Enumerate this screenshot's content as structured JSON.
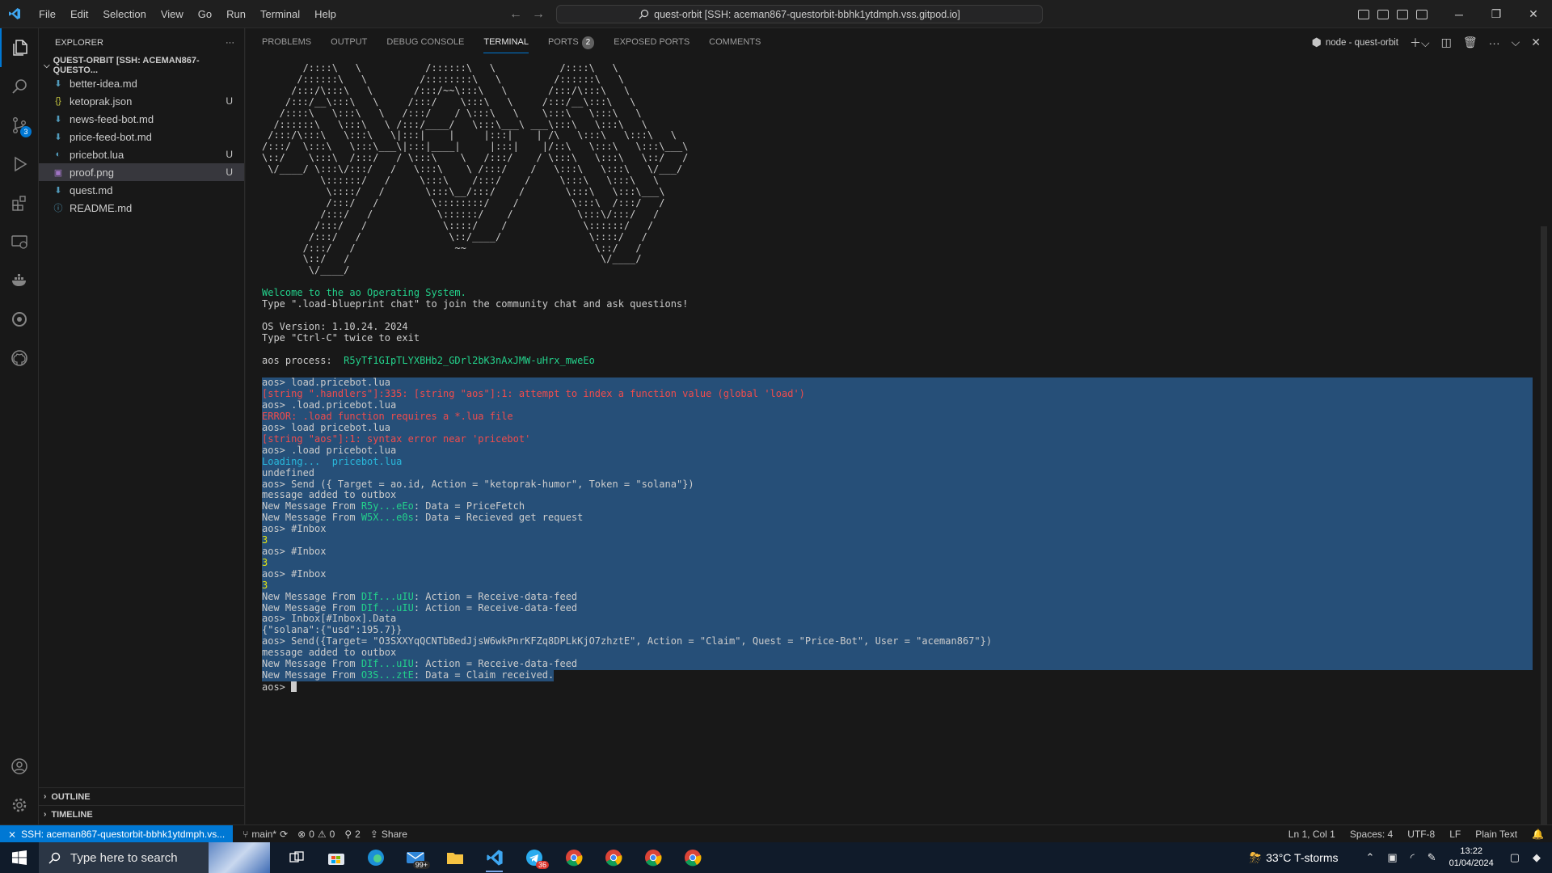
{
  "titlebar": {
    "menu": [
      "File",
      "Edit",
      "Selection",
      "View",
      "Go",
      "Run",
      "Terminal",
      "Help"
    ],
    "command_center": "quest-orbit [SSH: aceman867-questorbit-bbhk1ytdmph.vss.gitpod.io]"
  },
  "activitybar": {
    "scm_badge": "3"
  },
  "sidebar": {
    "title": "EXPLORER",
    "more": "···",
    "folder": "QUEST-ORBIT [SSH: ACEMAN867-QUESTO...",
    "files": [
      {
        "name": "better-idea.md",
        "icon": "markdown-icon",
        "status": ""
      },
      {
        "name": "ketoprak.json",
        "icon": "json-icon",
        "status": "U"
      },
      {
        "name": "news-feed-bot.md",
        "icon": "markdown-icon",
        "status": ""
      },
      {
        "name": "price-feed-bot.md",
        "icon": "markdown-icon",
        "status": ""
      },
      {
        "name": "pricebot.lua",
        "icon": "lua-icon",
        "status": "U"
      },
      {
        "name": "proof.png",
        "icon": "image-icon",
        "status": "U"
      },
      {
        "name": "quest.md",
        "icon": "markdown-icon",
        "status": ""
      },
      {
        "name": "README.md",
        "icon": "info-icon",
        "status": ""
      }
    ],
    "outline": "OUTLINE",
    "timeline": "TIMELINE"
  },
  "panel": {
    "tabs": [
      "PROBLEMS",
      "OUTPUT",
      "DEBUG CONSOLE",
      "TERMINAL",
      "PORTS",
      "EXPOSED PORTS",
      "COMMENTS"
    ],
    "ports_count": "2",
    "terminal_name": "node - quest-orbit"
  },
  "terminal": {
    "ascii_art": "       /::::\\   \\           /::::::\\   \\           /::::\\   \\\n      /::::::\\   \\         /::::::::\\   \\         /::::::\\   \\\n     /:::/\\:::\\   \\       /:::/~~\\:::\\   \\       /:::/\\:::\\   \\\n    /:::/__\\:::\\   \\     /:::/    \\:::\\   \\     /:::/__\\:::\\   \\\n   /::::\\   \\:::\\   \\   /:::/    / \\:::\\   \\    \\:::\\   \\:::\\   \\\n  /::::::\\   \\:::\\   \\ /:::/____/   \\:::\\___\\ ___\\:::\\   \\:::\\   \\\n /:::/\\:::\\   \\:::\\   \\|:::|    |     |:::|    | /\\   \\:::\\   \\:::\\   \\\n/:::/  \\:::\\   \\:::\\___\\|:::|____|     |:::|    |/::\\   \\:::\\   \\:::\\___\\\n\\::/    \\:::\\  /:::/   / \\:::\\    \\   /:::/    / \\:::\\   \\:::\\   \\::/   /\n \\/____/ \\:::\\/:::/   /   \\:::\\    \\ /:::/    /   \\:::\\   \\:::\\   \\/___/\n          \\::::::/   /     \\:::\\    /:::/    /     \\:::\\   \\:::\\   \\\n           \\::::/   /       \\:::\\__/:::/    /       \\:::\\   \\:::\\___\\\n           /:::/   /         \\::::::::/    /         \\:::\\  /:::/   /\n          /:::/   /           \\::::::/    /           \\:::\\/:::/   /\n         /:::/   /             \\::::/    /             \\::::::/   /\n        /:::/   /               \\::/____/               \\::::/   /\n       /:::/   /                 ~~                      \\::/   /\n       \\::/   /                                           \\/____/\n        \\/____/",
    "welcome": "Welcome to the ao Operating System.",
    "hint_chat": "Type \".load-blueprint chat\" to join the community chat and ask questions!",
    "os_version": "OS Version: 1.10.24. 2024",
    "hint_exit": "Type \"Ctrl-C\" twice to exit",
    "process_label": "aos process:",
    "process_id": "R5yTf1GIpTLYXBHb2_GDrl2bK3nAxJMW-uHrx_mweEo",
    "lines": [
      [
        {
          "t": "aos> load.pricebot.lua",
          "c": ""
        }
      ],
      [
        {
          "t": "[string \".handlers\"]:335: [string \"aos\"]:1: attempt to index a function value (global 'load')",
          "c": "red"
        }
      ],
      [
        {
          "t": "aos> .load.pricebot.lua",
          "c": ""
        }
      ],
      [
        {
          "t": "ERROR: .load function requires a *.lua file",
          "c": "red"
        }
      ],
      [
        {
          "t": "aos> load pricebot.lua",
          "c": ""
        }
      ],
      [
        {
          "t": "[string \"aos\"]:1: syntax error near 'pricebot'",
          "c": "red"
        }
      ],
      [
        {
          "t": "aos> .load pricebot.lua",
          "c": ""
        }
      ],
      [
        {
          "t": "Loading...  pricebot.lua",
          "c": "cyan"
        }
      ],
      [
        {
          "t": "undefined",
          "c": ""
        }
      ],
      [
        {
          "t": "aos> Send ({ Target = ao.id, Action = \"ketoprak-humor\", Token = \"solana\"})",
          "c": ""
        }
      ],
      [
        {
          "t": "message added to outbox",
          "c": ""
        }
      ],
      [
        {
          "t": "New Message From ",
          "c": ""
        },
        {
          "t": "R5y...eEo",
          "c": "green"
        },
        {
          "t": ": Data = PriceFetch",
          "c": ""
        }
      ],
      [
        {
          "t": "New Message From ",
          "c": ""
        },
        {
          "t": "W5X...e0s",
          "c": "green"
        },
        {
          "t": ": Data = Recieved get request",
          "c": ""
        }
      ],
      [
        {
          "t": "aos> #Inbox",
          "c": ""
        }
      ],
      [
        {
          "t": "3",
          "c": "yellow"
        }
      ],
      [
        {
          "t": "aos> #Inbox",
          "c": ""
        }
      ],
      [
        {
          "t": "3",
          "c": "yellow"
        }
      ],
      [
        {
          "t": "aos> #Inbox",
          "c": ""
        }
      ],
      [
        {
          "t": "3",
          "c": "yellow"
        }
      ],
      [
        {
          "t": "New Message From ",
          "c": ""
        },
        {
          "t": "DIf...uIU",
          "c": "green"
        },
        {
          "t": ": Action = Receive-data-feed",
          "c": ""
        }
      ],
      [
        {
          "t": "New Message From ",
          "c": ""
        },
        {
          "t": "DIf...uIU",
          "c": "green"
        },
        {
          "t": ": Action = Receive-data-feed",
          "c": ""
        }
      ],
      [
        {
          "t": "aos> Inbox[#Inbox].Data",
          "c": ""
        }
      ],
      [
        {
          "t": "{\"solana\":{\"usd\":195.7}}",
          "c": ""
        }
      ],
      [
        {
          "t": "aos> Send({Target= \"O3SXXYqQCNTbBedJjsW6wkPnrKFZq8DPLkKjO7zhztE\", Action = \"Claim\", Quest = \"Price-Bot\", User = \"aceman867\"})",
          "c": ""
        }
      ],
      [
        {
          "t": "message added to outbox",
          "c": ""
        }
      ],
      [
        {
          "t": "New Message From ",
          "c": ""
        },
        {
          "t": "DIf...uIU",
          "c": "green"
        },
        {
          "t": ": Action = Receive-data-feed",
          "c": ""
        }
      ]
    ],
    "last_line": [
      {
        "t": "New Message From ",
        "c": ""
      },
      {
        "t": "O3S...ztE",
        "c": "green"
      },
      {
        "t": ": Data = Claim received.",
        "c": ""
      }
    ],
    "prompt": "aos> "
  },
  "statusbar": {
    "remote": "SSH: aceman867-questorbit-bbhk1ytdmph.vs...",
    "branch": "main*",
    "errors": "0",
    "warnings": "0",
    "ports": "2",
    "share": "Share",
    "position": "Ln 1, Col 1",
    "spaces": "Spaces: 4",
    "encoding": "UTF-8",
    "eol": "LF",
    "language": "Plain Text"
  },
  "taskbar": {
    "search_placeholder": "Type here to search",
    "mail_badge": "99+",
    "telegram_badge": "36",
    "weather": "33°C  T-storms",
    "time": "13:22",
    "date": "01/04/2024"
  },
  "colors": {
    "accent": "#0078d4",
    "terminal_green": "#23d18b",
    "terminal_red": "#f14c4c",
    "terminal_cyan": "#29b8db",
    "terminal_yellow": "#e5e510",
    "selection": "#264f78"
  }
}
